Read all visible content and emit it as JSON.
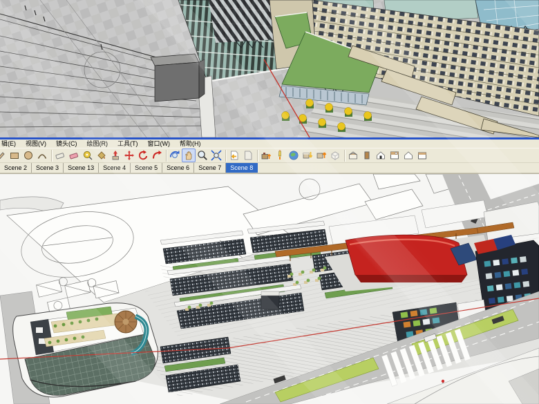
{
  "menu": {
    "items": [
      "辑(E)",
      "视图(V)",
      "镜头(C)",
      "绘图(R)",
      "工具(T)",
      "窗口(W)",
      "帮助(H)"
    ]
  },
  "toolbar": {
    "icons": [
      {
        "name": "pencil-tool-icon",
        "clipped": true
      },
      {
        "name": "rectangle-tool-icon"
      },
      {
        "name": "circle-tool-icon"
      },
      {
        "name": "arc-tool-icon"
      },
      {
        "name": "eraser-tool-icon",
        "divider_before": true
      },
      {
        "name": "follow-me-tool-icon"
      },
      {
        "name": "tape-measure-icon"
      },
      {
        "name": "paint-bucket-icon"
      },
      {
        "name": "push-pull-icon"
      },
      {
        "name": "move-icon"
      },
      {
        "name": "rotate-icon"
      },
      {
        "name": "offset-icon"
      },
      {
        "name": "orbit-icon",
        "divider_before": true
      },
      {
        "name": "pan-icon",
        "pressed": true
      },
      {
        "name": "zoom-icon"
      },
      {
        "name": "zoom-extents-icon"
      },
      {
        "name": "previous-view-icon",
        "divider_before": true
      },
      {
        "name": "next-view-icon"
      },
      {
        "name": "add-location-icon",
        "divider_before": true
      },
      {
        "name": "photo-textures-icon"
      },
      {
        "name": "google-earth-icon"
      },
      {
        "name": "get-models-icon"
      },
      {
        "name": "share-model-icon"
      },
      {
        "name": "component-box-icon"
      },
      {
        "name": "iso-view-icon",
        "divider_before": true
      },
      {
        "name": "left-view-icon"
      },
      {
        "name": "front-view-icon"
      },
      {
        "name": "top-view-icon"
      },
      {
        "name": "back-view-icon"
      },
      {
        "name": "right-view-icon"
      }
    ]
  },
  "scene_tabs": {
    "tabs": [
      "Scene 2",
      "Scene 3",
      "Scene 13",
      "Scene 4",
      "Scene 5",
      "Scene 6",
      "Scene 7",
      "Scene 8"
    ],
    "active": "Scene 8"
  },
  "colors": {
    "chrome_bg": "#ece9d8",
    "divider_blue": "#2753c9",
    "active_tab_bg": "#316ac5",
    "active_tab_text": "#ffffff",
    "canopy_red": "#c5231f",
    "lawn_green": "#7cab5e",
    "median_green": "#b8cf62",
    "road_gray": "#c2c2c0",
    "survey_line_red": "#c43a32"
  }
}
